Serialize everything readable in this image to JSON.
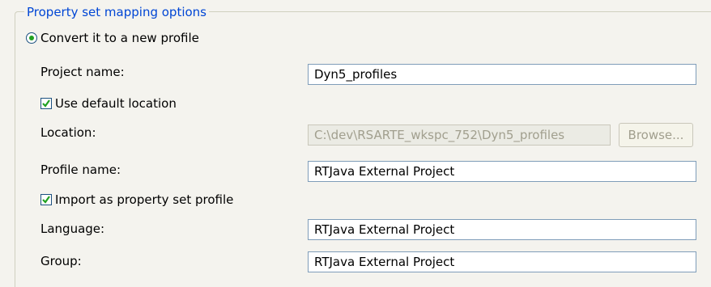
{
  "group": {
    "title": "Property set mapping options"
  },
  "convert_option": {
    "label": "Convert it to a new profile",
    "selected": true
  },
  "project_name": {
    "label": "Project name:",
    "value": "Dyn5_profiles"
  },
  "use_default_location": {
    "label": "Use default location",
    "checked": true
  },
  "location": {
    "label": "Location:",
    "value": "C:\\dev\\RSARTE_wkspc_752\\Dyn5_profiles",
    "enabled": false
  },
  "browse": {
    "label": "Browse...",
    "enabled": false
  },
  "profile_name": {
    "label": "Profile name:",
    "value": "RTJava External Project"
  },
  "import_as_profile": {
    "label": "Import as property set profile",
    "checked": true
  },
  "language": {
    "label": "Language:",
    "value": "RTJava External Project"
  },
  "group_field": {
    "label": "Group:",
    "value": "RTJava External Project"
  }
}
